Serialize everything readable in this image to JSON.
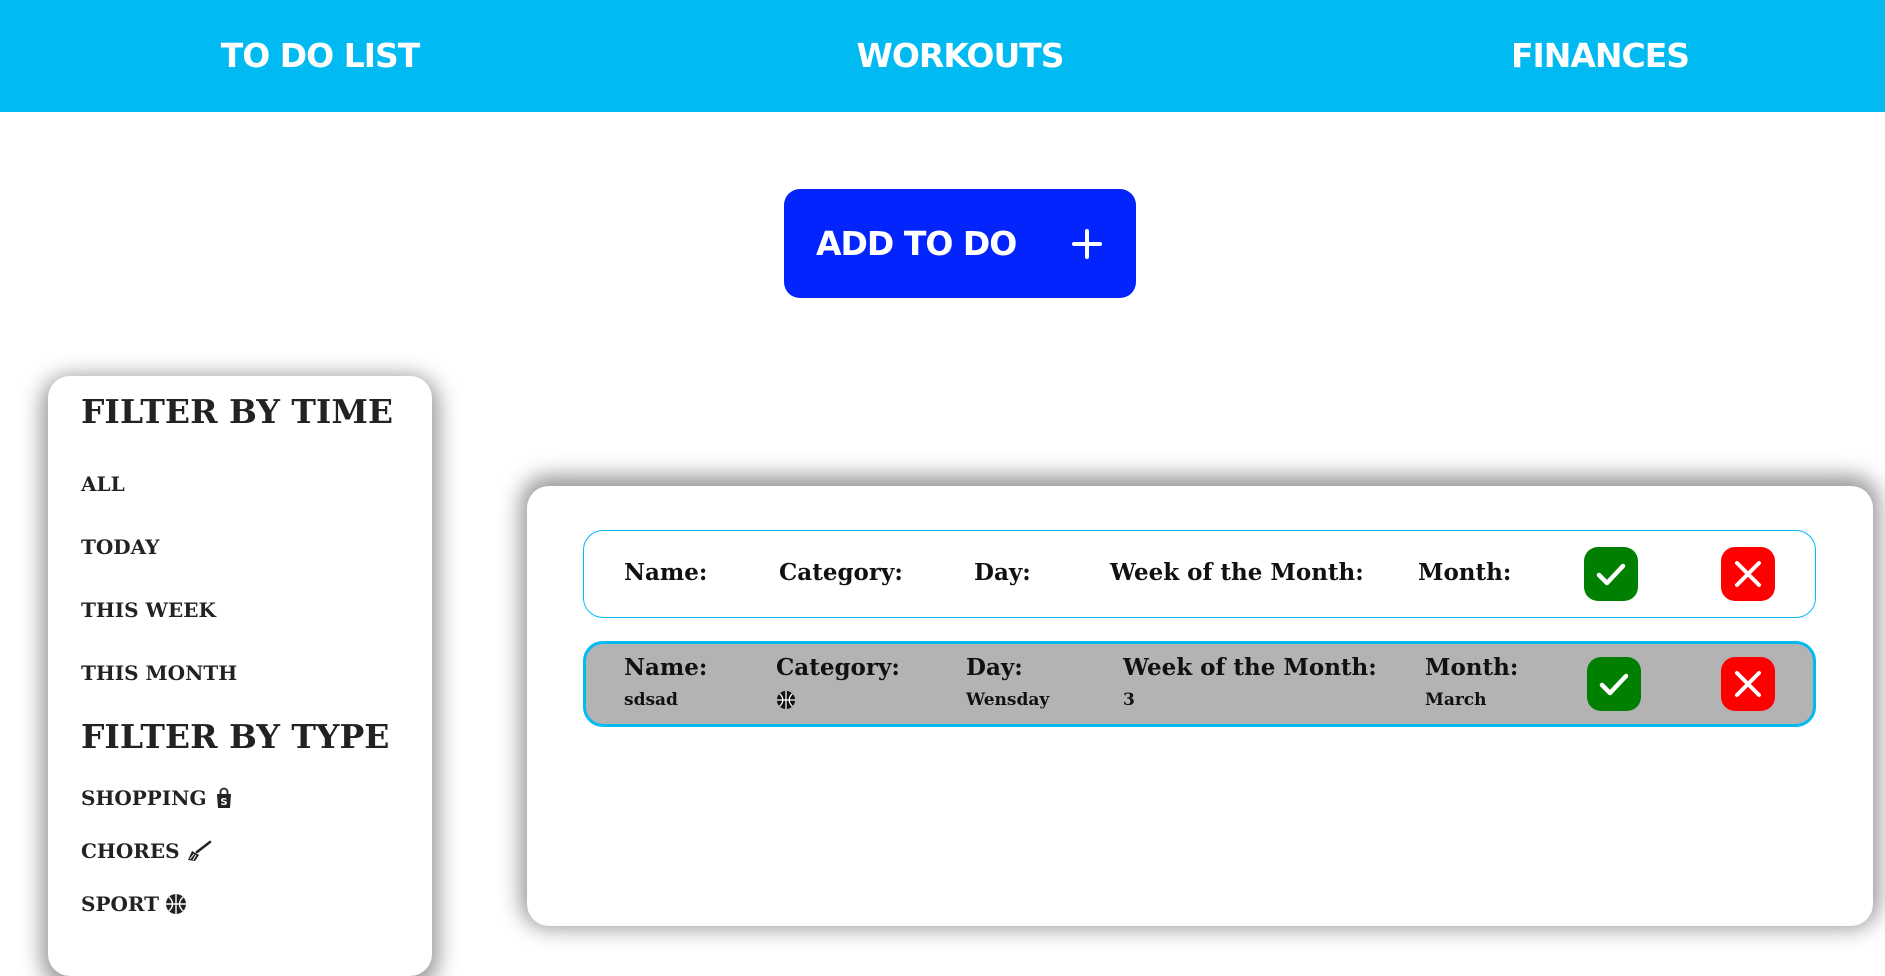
{
  "nav": {
    "todo_label": "TO DO LIST",
    "workouts_label": "WORKOUTS",
    "finances_label": "FINANCES",
    "bg_color": "#02BAF2"
  },
  "add_button": {
    "label": "ADD TO DO",
    "icon": "plus-icon",
    "color": "#0324FC"
  },
  "filters": {
    "time_heading": "FILTER BY TIME",
    "time_items": [
      "ALL",
      "TODAY",
      "THIS WEEK",
      "THIS MONTH"
    ],
    "type_heading": "FILTER BY TYPE",
    "type_items": [
      {
        "label": "SHOPPING",
        "icon": "shopping-bag-icon"
      },
      {
        "label": "CHORES",
        "icon": "broom-icon"
      },
      {
        "label": "SPORT",
        "icon": "basketball-icon"
      }
    ]
  },
  "todo_list": {
    "labels": {
      "name": "Name:",
      "category": "Category:",
      "day": "Day:",
      "week": "Week of the Month:",
      "month": "Month:"
    },
    "rows": [
      {
        "name": "",
        "category_icon": "",
        "day": "",
        "week": "",
        "month": "",
        "highlighted": false
      },
      {
        "name": "sdsad",
        "category_icon": "basketball-icon",
        "day": "Wensday",
        "week": "3",
        "month": "March",
        "highlighted": true
      }
    ],
    "complete_color": "#008000",
    "delete_color": "#FF0000",
    "highlight_color": "#B3B3B3"
  }
}
